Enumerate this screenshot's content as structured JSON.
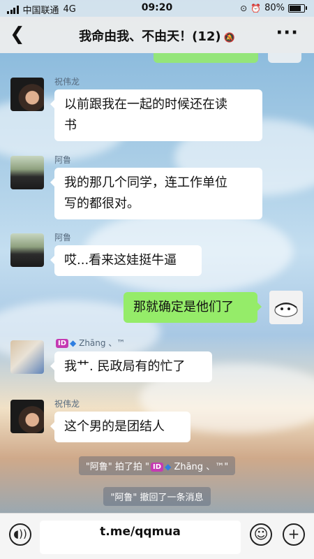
{
  "status_bar": {
    "carrier": "中国联通",
    "network": "4G",
    "time": "09:20",
    "battery": "80%"
  },
  "nav": {
    "title": "我命由我、不由天！(12)"
  },
  "messages": [
    {
      "sender": "祝伟龙",
      "text_line1": "以前跟我在一起的时候还在读",
      "text_line2": "书"
    },
    {
      "sender": "阿鲁",
      "text_line1": "我的那几个同学，连工作单位",
      "text_line2": "写的都很对。"
    },
    {
      "sender": "阿鲁",
      "text": "哎...看来这娃挺牛逼"
    },
    {
      "text": "那就确定是他们了"
    },
    {
      "sender_badge": "ID",
      "sender_name": "Zhāng",
      "sender_suffix": "、™",
      "text": "我艹. 民政局有的忙了"
    },
    {
      "sender": "祝伟龙",
      "text": "这个男的是团结人"
    }
  ],
  "system_messages": {
    "pat": {
      "prefix": "\"阿鲁\" 拍了拍 \"",
      "badge": "ID",
      "name": "Zhāng",
      "suffix": "、™\""
    },
    "recall": "\"阿鲁\" 撤回了一条消息"
  },
  "input": {
    "value": "t.me/qqmua"
  },
  "colors": {
    "bubble_self": "#95ec69",
    "bubble_other": "#ffffff",
    "id_badge": "#c53ab2"
  }
}
